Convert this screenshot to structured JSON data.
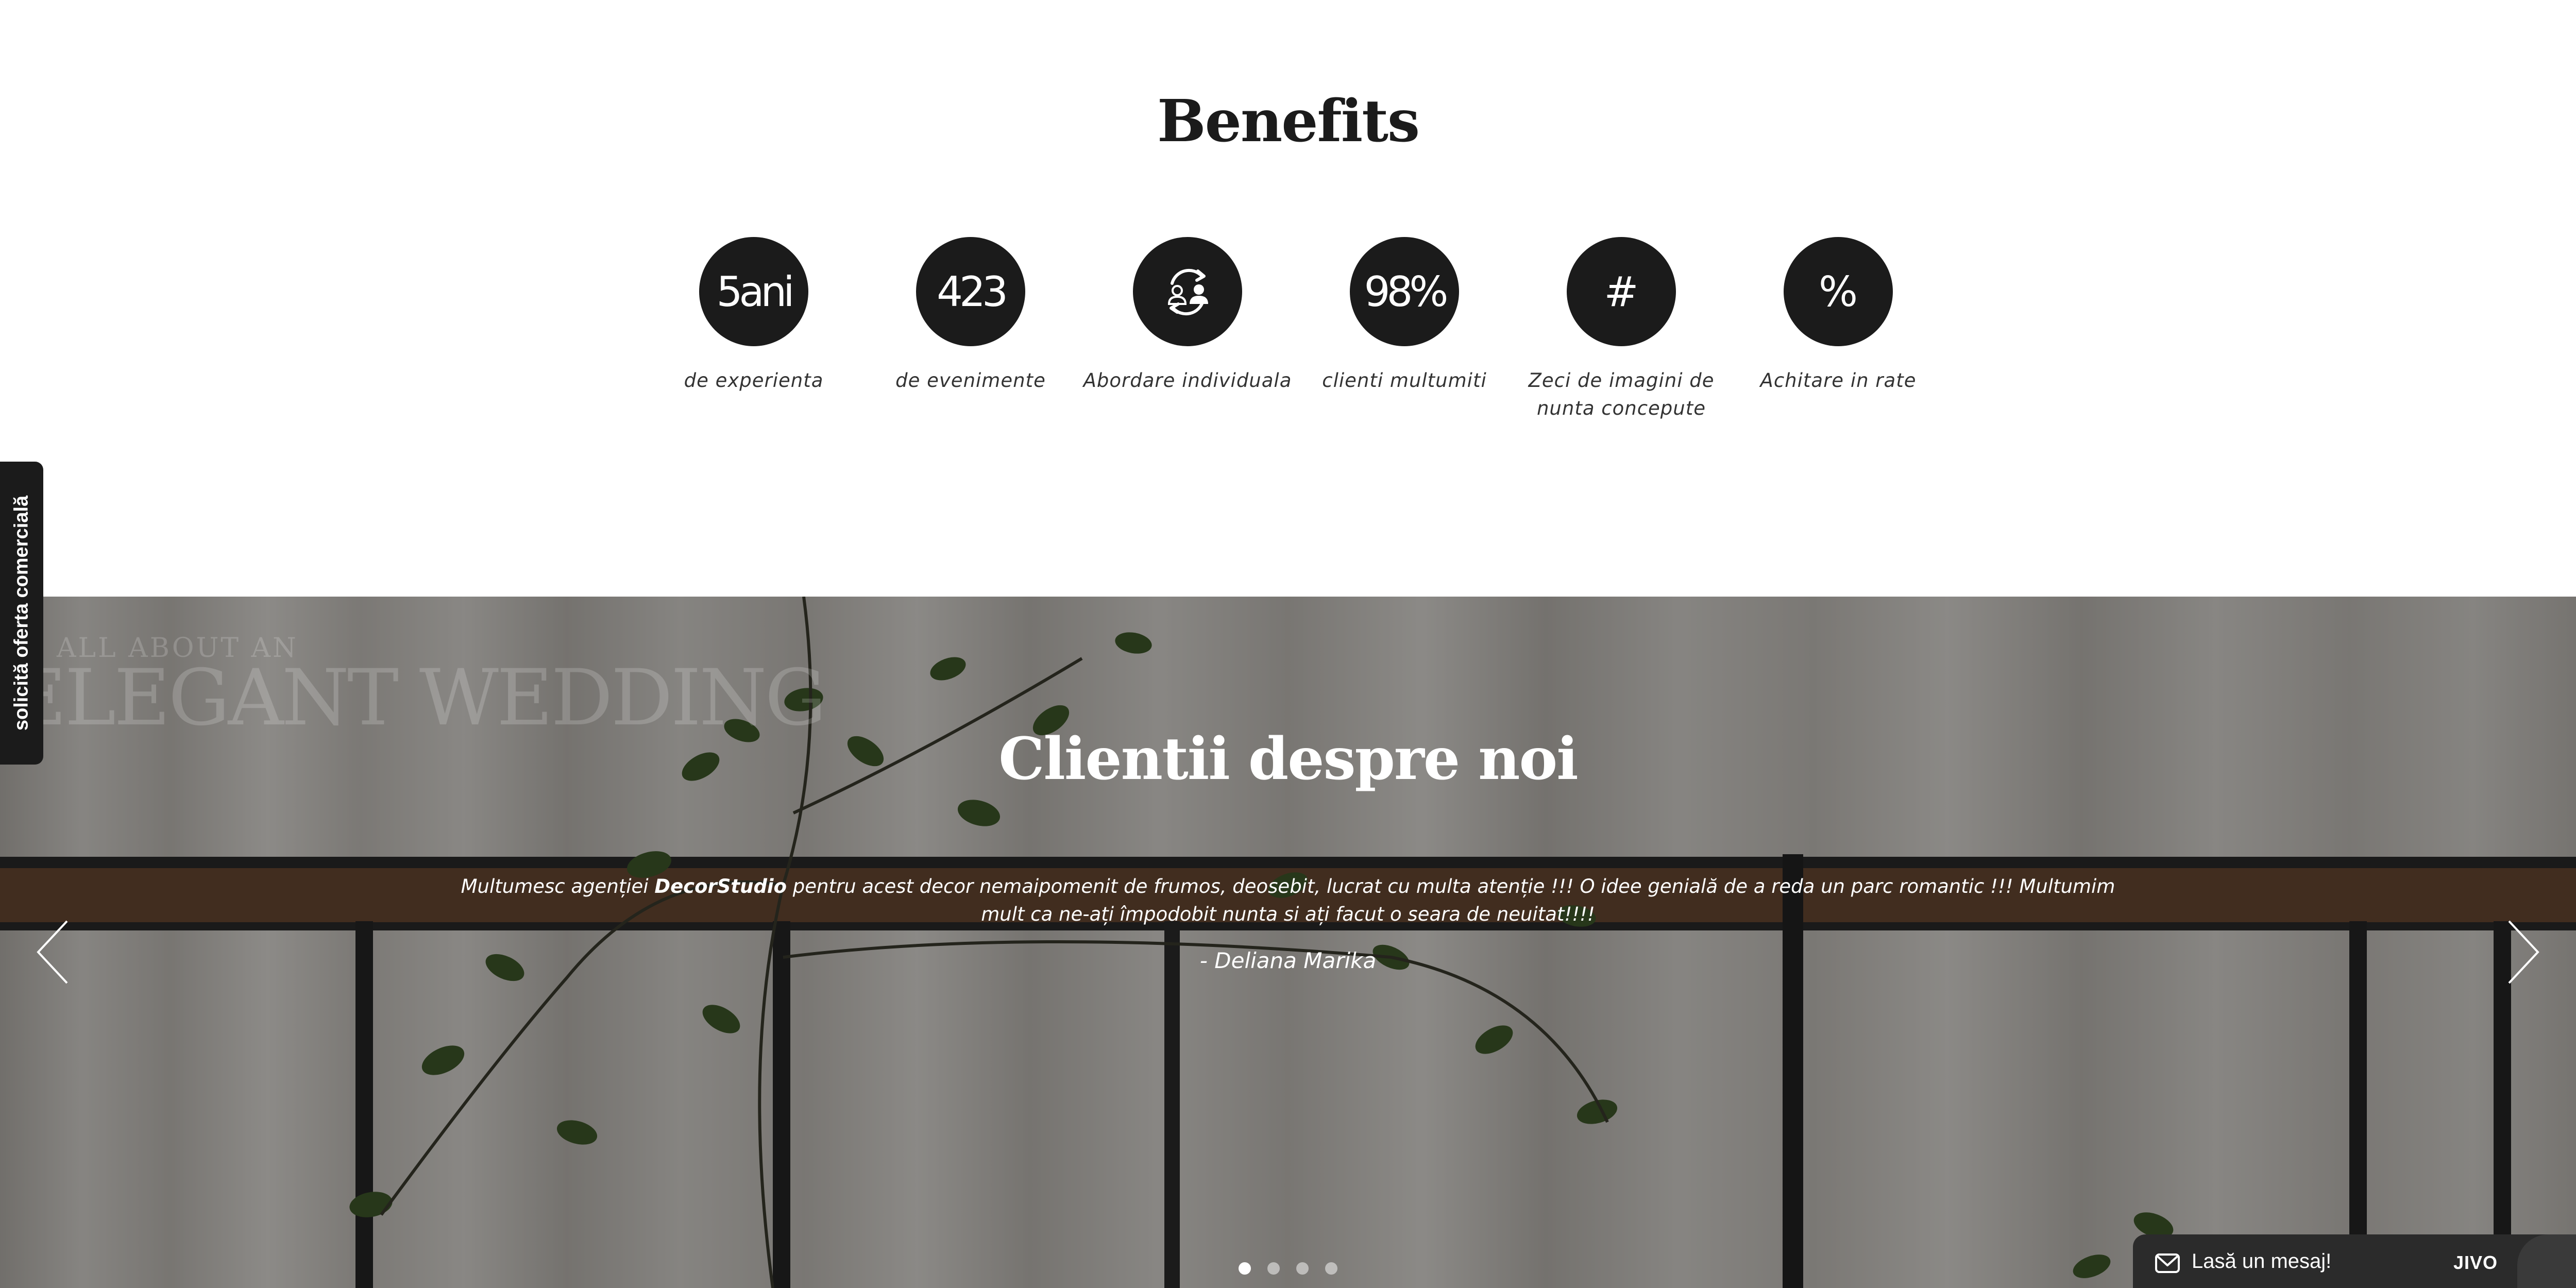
{
  "benefits": {
    "title": "Benefits",
    "items": [
      {
        "value": "5ani",
        "label": "de experienta"
      },
      {
        "value": "423",
        "label": "de evenimente"
      },
      {
        "icon": "people-exchange-icon",
        "label": "Abordare individuala"
      },
      {
        "value": "98%",
        "label": "clienti multumiti"
      },
      {
        "value": "#",
        "label": "Zeci de imagini de nunta concepute"
      },
      {
        "value": "%",
        "label": "Achitare in rate"
      }
    ]
  },
  "side_tab": {
    "label": "solicită oferta comercială"
  },
  "testimonials": {
    "watermark_small": "ALL ABOUT AN",
    "watermark_big": "ELEGANT WEDDING",
    "title": "Clientii despre noi",
    "quote_before": "Multumesc agenției ",
    "quote_brand": "DecorStudio",
    "quote_after": " pentru acest decor nemaipomenit de frumos, deosebit, lucrat cu multa atenție !!! O idee genială de a reda un parc romantic !!! Multumim mult ca ne-ați împodobit nunta si ați facut o seara de neuitat!!!!",
    "author": "- Deliana Marika",
    "slide_count": 4,
    "active_slide": 1
  },
  "chat_widget": {
    "label": "Lasă un mesaj!",
    "brand": "JIVO"
  },
  "colors": {
    "dark": "#1b1b1b",
    "white": "#ffffff",
    "chat_bg": "#2b2b2b"
  }
}
